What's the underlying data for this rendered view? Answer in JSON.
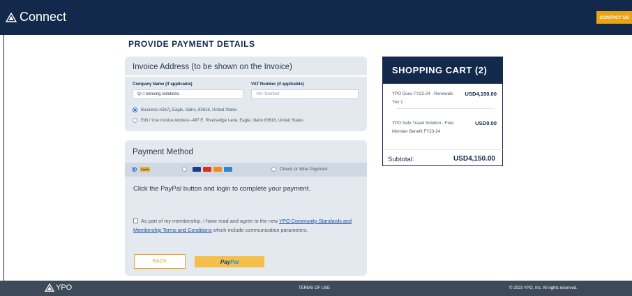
{
  "header": {
    "brand": "Connect",
    "contact_label": "CONTACT US"
  },
  "page": {
    "title": "PROVIDE PAYMENT DETAILS"
  },
  "invoice": {
    "heading": "Invoice Address (to be shown on the Invoice)",
    "company_label": "Company Name (if applicable)",
    "company_value": "QTI Sensing Solutions",
    "vat_label": "VAT Number (if applicable)",
    "vat_placeholder": "VAT Number",
    "address_option_1": "Business-HJb7j, Eagle, Idaho, 83616, United States",
    "address_option_2": "Edit / Use Invoice Address -487 E. Riversedge Lane, Eagle, Idaho 83616, United States",
    "selected_option": 1
  },
  "payment": {
    "heading": "Payment Method",
    "paypal_mini": "PayPal",
    "check_label": "Check or Wire Payment",
    "instruction": "Click the PayPal button and login to complete your payment.",
    "agree_prefix": "As part of my membership, I have read and agree to the new ",
    "agree_link": "YPO Community Standards and Membership Terms and Conditions",
    "agree_suffix": " which include communication parameters.",
    "back_label": "BACK",
    "paypal_pay": "Pay",
    "paypal_pal": "Pal",
    "selected_method": "paypal"
  },
  "cart": {
    "title": "SHOPPING CART (2)",
    "items": [
      {
        "name": "YPO Dues FY23-24 - Renewals Tier 1",
        "price": "USD4,150.00"
      },
      {
        "name": "YPO Safe Travel Solution - Free Member Benefit FY23-24",
        "price": "USD0.00"
      }
    ],
    "subtotal_label": "Subtotal:",
    "subtotal_value": "USD4,150.00"
  },
  "footer": {
    "brand": "YPO",
    "terms": "TERMS OF USE",
    "copyright": "© 2023 YPO, Inc. All rights reserved."
  },
  "colors": {
    "navy": "#13294b",
    "accent": "#e8a317",
    "panel": "#e4e9ef",
    "footer": "#3d4a5a"
  },
  "icons": {
    "logo": "triangle-logo-icon",
    "cards": [
      "visa-icon",
      "mastercard-icon",
      "discover-icon",
      "amex-icon"
    ]
  }
}
